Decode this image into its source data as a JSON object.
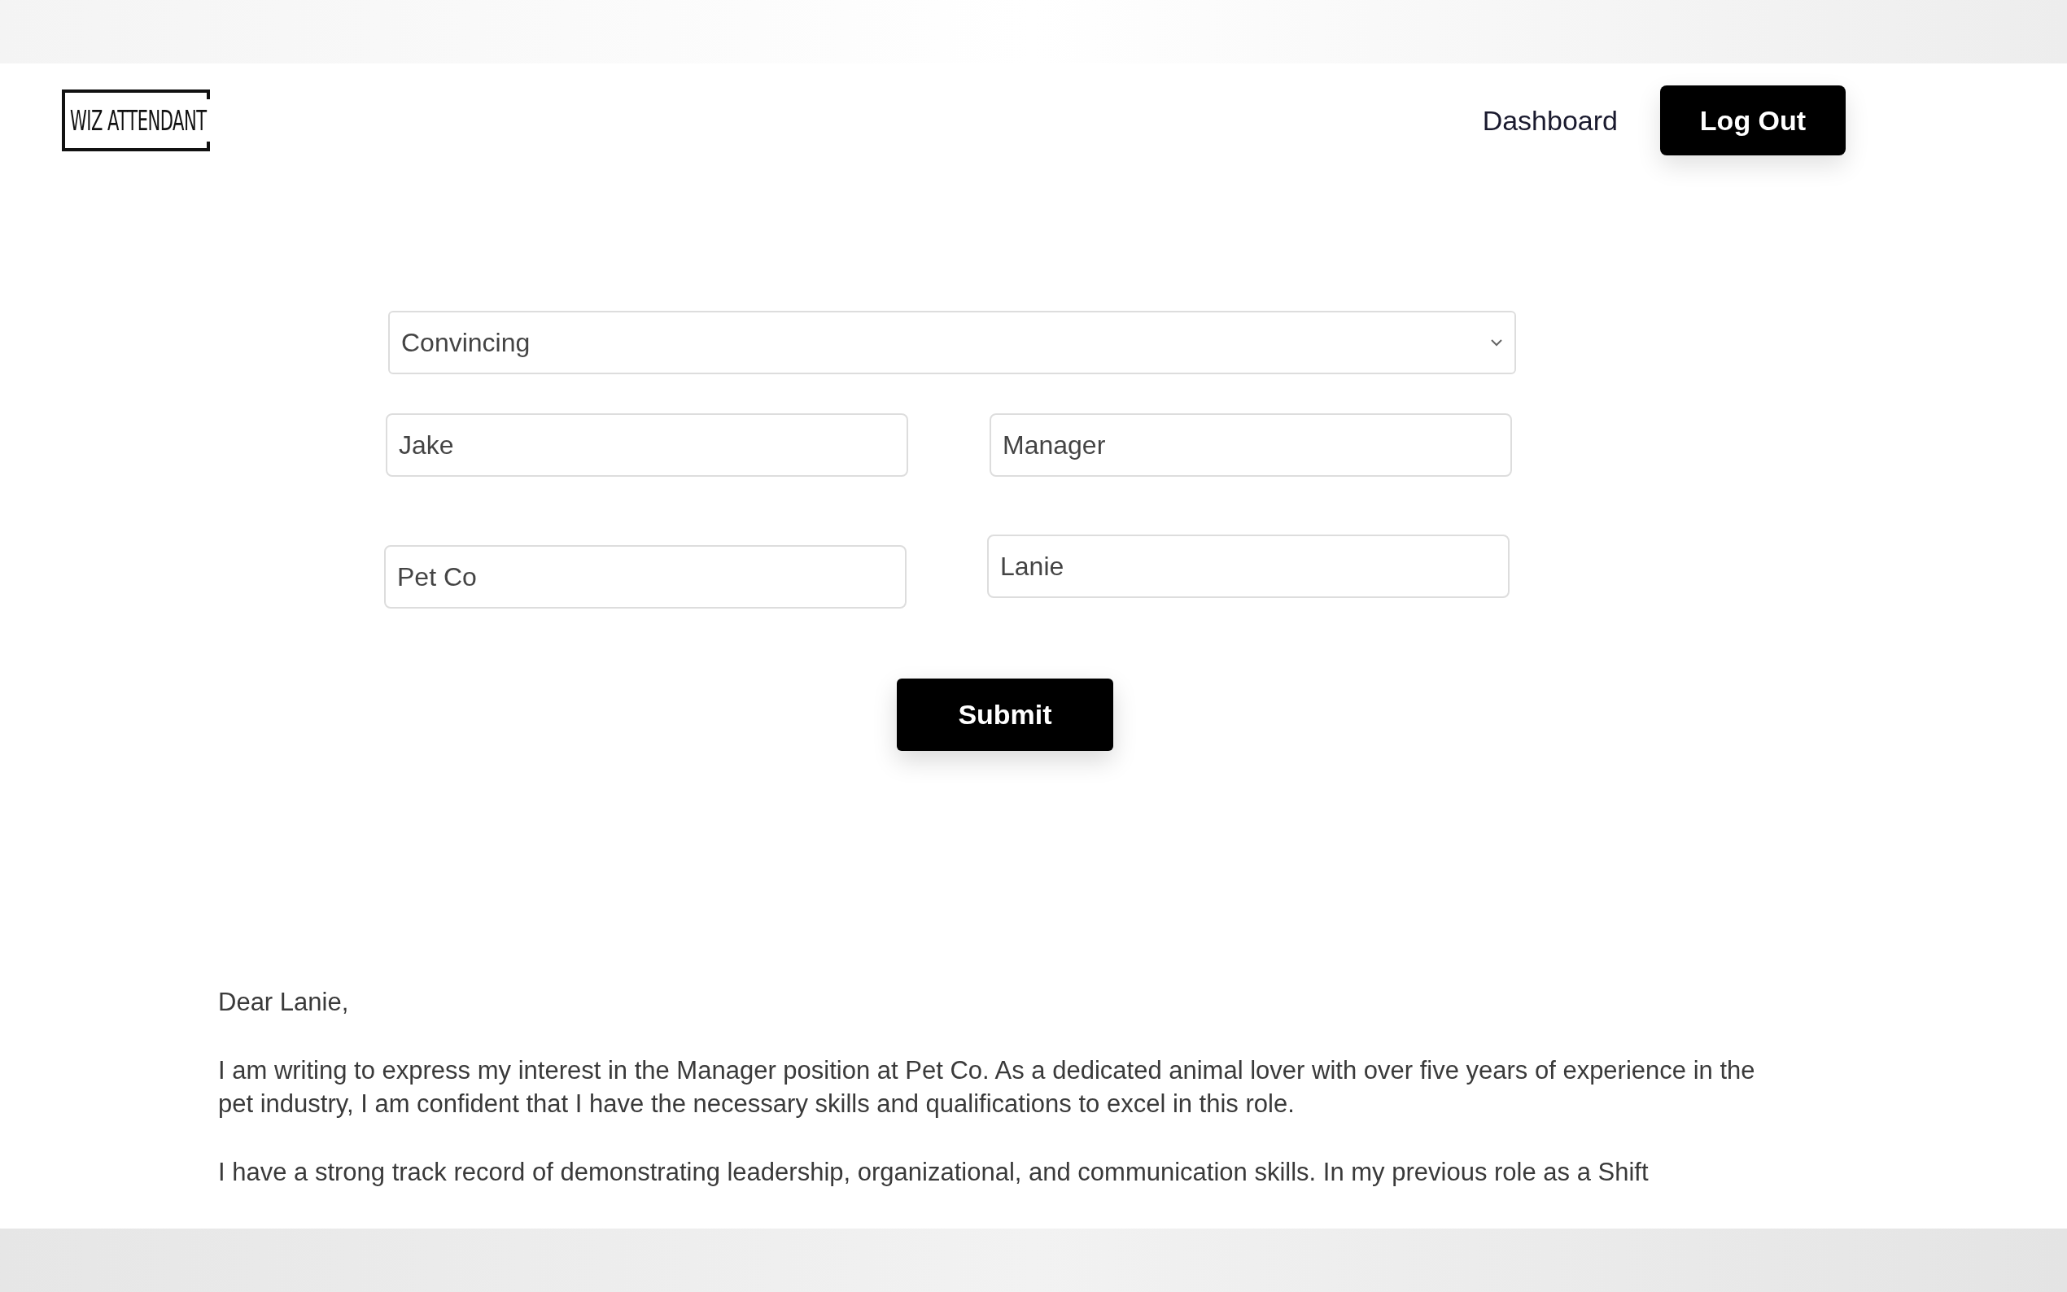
{
  "logo": {
    "text": "WIZ ATTENDANT"
  },
  "nav": {
    "links": [
      "Dashboard"
    ],
    "button": "Log Out"
  },
  "form": {
    "tone": {
      "value": "Convincing"
    },
    "fields": [
      {
        "value": "Jake"
      },
      {
        "value": "Manager"
      },
      {
        "value": "Pet Co"
      },
      {
        "value": "Lanie"
      }
    ],
    "submit": "Submit"
  },
  "letter": {
    "paragraphs": [
      "Dear Lanie,",
      "I am writing to express my interest in the Manager position at Pet Co. As a dedicated animal lover with over five years of experience in the pet industry, I am confident that I have the necessary skills and qualifications to excel in this role.",
      "I have a strong track record of demonstrating leadership, organizational, and communication skills. In my previous role as a Shift"
    ]
  }
}
